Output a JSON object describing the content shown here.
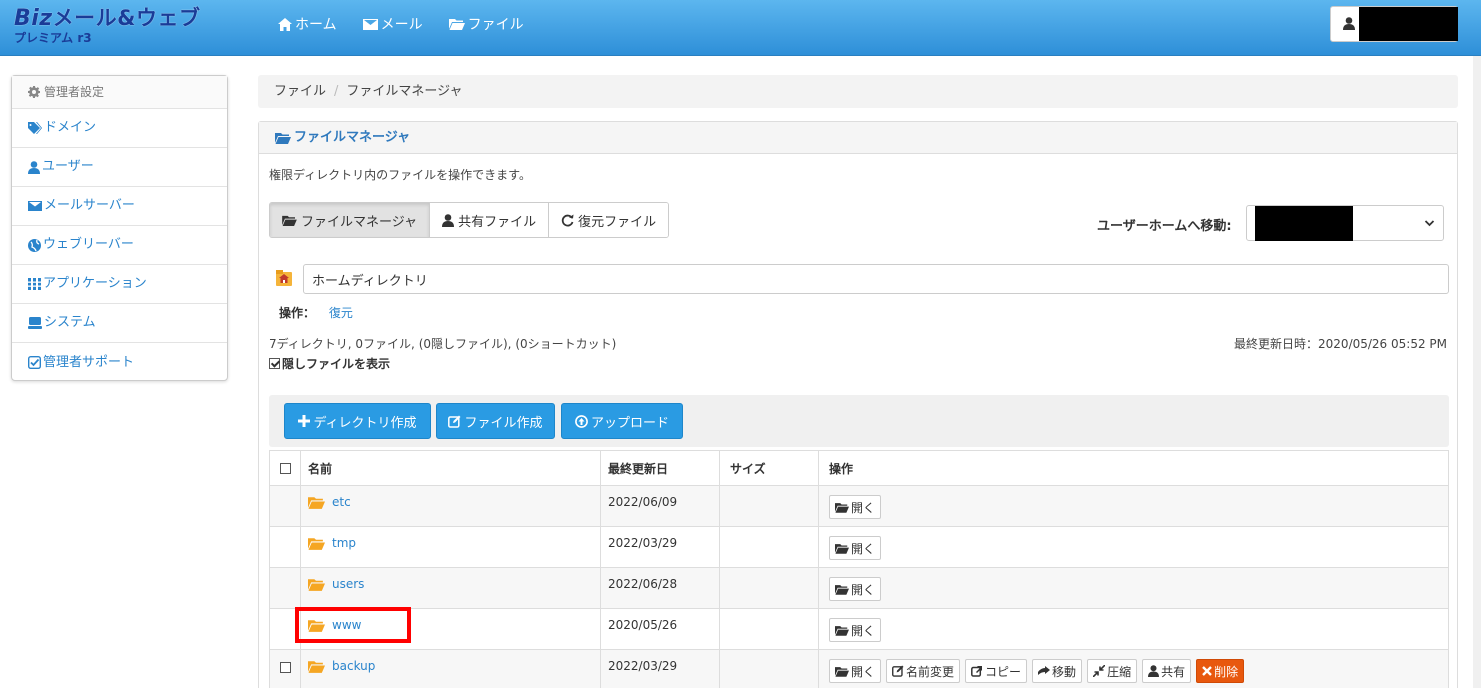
{
  "header": {
    "logo_line1_biz": "Biz",
    "logo_line1_rest": "メール&ウェブ",
    "logo_line2": "プレミアム r3",
    "nav": [
      {
        "label": "ホーム",
        "icon": "home-icon"
      },
      {
        "label": "メール",
        "icon": "mail-icon"
      },
      {
        "label": "ファイル",
        "icon": "folder-icon"
      }
    ],
    "user_icon": "user-icon"
  },
  "sidebar": {
    "title": "管理者設定",
    "items": [
      {
        "label": "ドメイン",
        "icon": "tag-icon"
      },
      {
        "label": "ユーザー",
        "icon": "user-icon"
      },
      {
        "label": "メールサーバー",
        "icon": "mail-icon"
      },
      {
        "label": "ウェブリーバー",
        "icon": "globe-icon"
      },
      {
        "label": "アプリケーション",
        "icon": "apps-icon"
      },
      {
        "label": "システム",
        "icon": "server-icon"
      },
      {
        "label": "管理者サポート",
        "icon": "check-square-icon"
      }
    ]
  },
  "breadcrumb": {
    "items": [
      "ファイル",
      "ファイルマネージャ"
    ],
    "separator": "/"
  },
  "panel": {
    "title": "ファイルマネージャ",
    "description": "権限ディレクトリ内のファイルを操作できます。",
    "tabs": [
      {
        "label": "ファイルマネージャ",
        "icon": "folder-open-icon",
        "active": true
      },
      {
        "label": "共有ファイル",
        "icon": "user-icon",
        "active": false
      },
      {
        "label": "復元ファイル",
        "icon": "refresh-icon",
        "active": false
      }
    ],
    "move_label": "ユーザーホームへ移動:",
    "path_value": "ホームディレクトリ",
    "operation_label": "操作：",
    "operation_link": "復元",
    "summary": "7ディレクトリ, 0ファイル, (0隠しファイル), (0ショートカット)",
    "last_updated": "最終更新日時：2020/05/26 05:52 PM",
    "show_hidden_label": "隠しファイルを表示",
    "show_hidden_checked": true,
    "actions": [
      {
        "label": "ディレクトリ作成",
        "icon": "plus-icon"
      },
      {
        "label": "ファイル作成",
        "icon": "edit-icon"
      },
      {
        "label": "アップロード",
        "icon": "upload-icon"
      }
    ]
  },
  "table": {
    "columns": [
      "名前",
      "最終更新日",
      "サイズ",
      "操作"
    ],
    "rows": [
      {
        "name": "etc",
        "date": "2022/06/09",
        "size": "",
        "checkbox": false
      },
      {
        "name": "tmp",
        "date": "2022/03/29",
        "size": "",
        "checkbox": false
      },
      {
        "name": "users",
        "date": "2022/06/28",
        "size": "",
        "checkbox": false
      },
      {
        "name": "www",
        "date": "2020/05/26",
        "size": "",
        "checkbox": false
      },
      {
        "name": "backup",
        "date": "2022/03/29",
        "size": "",
        "checkbox": true
      }
    ],
    "open_label": "開く",
    "row_actions": [
      {
        "label": "開く",
        "icon": "folder-open-icon"
      },
      {
        "label": "名前変更",
        "icon": "edit-icon"
      },
      {
        "label": "コピー",
        "icon": "copy-icon"
      },
      {
        "label": "移動",
        "icon": "arrow-right-icon"
      },
      {
        "label": "圧縮",
        "icon": "compress-icon"
      },
      {
        "label": "共有",
        "icon": "user-icon"
      },
      {
        "label": "削除",
        "icon": "close-icon"
      }
    ]
  },
  "colors": {
    "nav_bg": "#2e8fd8",
    "link": "#2a84cc",
    "primary_button": "#2a9be3",
    "danger_button": "#e8580e",
    "folder": "#f5a623",
    "highlight": "#ff0000"
  }
}
